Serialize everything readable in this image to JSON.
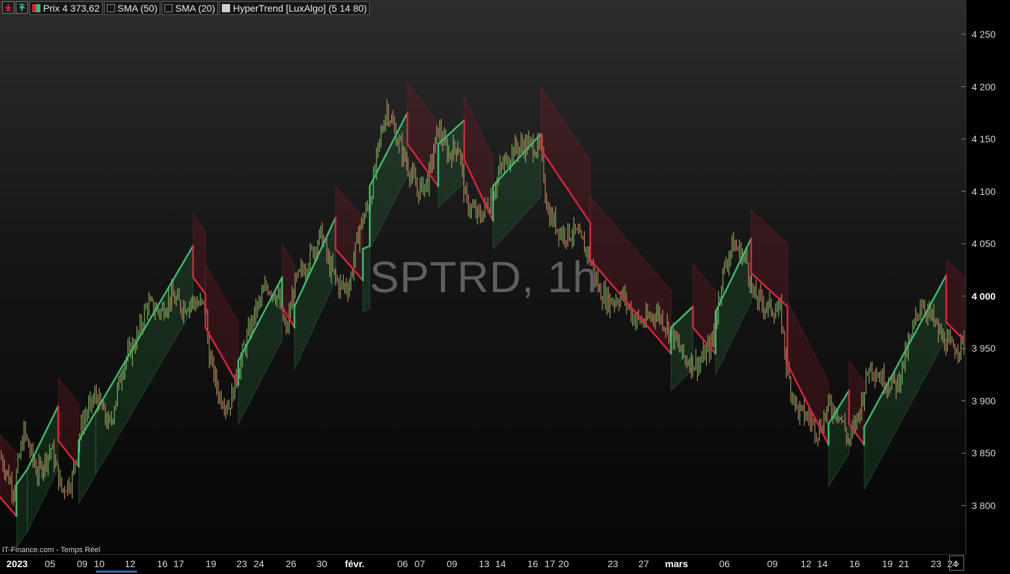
{
  "legend": {
    "price_label": "Prix 4 373,62",
    "sma50_label": "SMA (50)",
    "sma20_label": "SMA (20)",
    "hypertrend_label": "HyperTrend [LuxAlgo] (5 14 80)"
  },
  "watermark": "SPTRD, 1h",
  "source": "IT-Finance.com - Temps Réel",
  "colors": {
    "bull": "#3dbd6e",
    "bear": "#e0223f",
    "candle_up": "#8fd16a",
    "candle_down": "#d99a6a"
  },
  "chart_data": {
    "type": "line",
    "title": "SPTRD, 1h",
    "ylim": [
      3760,
      4280
    ],
    "y_ticks": [
      "4 250",
      "4 200",
      "4 150",
      "4 100",
      "4 050",
      "4 000",
      "3 950",
      "3 900",
      "3 850",
      "3 800"
    ],
    "x_ticks": [
      "2023",
      "05",
      "09",
      "10",
      "12",
      "16",
      "17",
      "19",
      "23",
      "24",
      "26",
      "30",
      "févr.",
      "06",
      "07",
      "09",
      "13",
      "14",
      "16",
      "17",
      "20",
      "23",
      "27",
      "mars",
      "06",
      "09",
      "12",
      "14",
      "16",
      "19",
      "21",
      "23",
      "24"
    ],
    "price": [
      [
        0,
        3848
      ],
      [
        20,
        3815
      ],
      [
        35,
        3870
      ],
      [
        55,
        3830
      ],
      [
        75,
        3855
      ],
      [
        90,
        3815
      ],
      [
        105,
        3825
      ],
      [
        120,
        3880
      ],
      [
        140,
        3905
      ],
      [
        160,
        3875
      ],
      [
        180,
        3935
      ],
      [
        200,
        3960
      ],
      [
        215,
        3992
      ],
      [
        235,
        3985
      ],
      [
        250,
        4000
      ],
      [
        265,
        3990
      ],
      [
        280,
        3995
      ],
      [
        300,
        3990
      ],
      [
        305,
        3945
      ],
      [
        320,
        3905
      ],
      [
        335,
        3895
      ],
      [
        350,
        3935
      ],
      [
        370,
        3980
      ],
      [
        390,
        4010
      ],
      [
        405,
        4000
      ],
      [
        418,
        3965
      ],
      [
        430,
        4010
      ],
      [
        450,
        4035
      ],
      [
        470,
        4060
      ],
      [
        480,
        4030
      ],
      [
        495,
        4010
      ],
      [
        510,
        4010
      ],
      [
        525,
        4065
      ],
      [
        540,
        4090
      ],
      [
        555,
        4150
      ],
      [
        565,
        4180
      ],
      [
        580,
        4150
      ],
      [
        595,
        4125
      ],
      [
        610,
        4100
      ],
      [
        625,
        4110
      ],
      [
        640,
        4160
      ],
      [
        655,
        4135
      ],
      [
        670,
        4145
      ],
      [
        680,
        4090
      ],
      [
        700,
        4075
      ],
      [
        715,
        4090
      ],
      [
        730,
        4120
      ],
      [
        750,
        4140
      ],
      [
        770,
        4145
      ],
      [
        790,
        4140
      ],
      [
        800,
        4080
      ],
      [
        820,
        4060
      ],
      [
        840,
        4060
      ],
      [
        860,
        4040
      ],
      [
        875,
        4005
      ],
      [
        890,
        3995
      ],
      [
        910,
        4000
      ],
      [
        925,
        3980
      ],
      [
        940,
        3975
      ],
      [
        960,
        3985
      ],
      [
        980,
        3965
      ],
      [
        1000,
        3940
      ],
      [
        1020,
        3935
      ],
      [
        1040,
        3955
      ],
      [
        1055,
        4020
      ],
      [
        1070,
        4050
      ],
      [
        1090,
        4035
      ],
      [
        1100,
        4000
      ],
      [
        1120,
        3990
      ],
      [
        1140,
        3985
      ],
      [
        1150,
        3925
      ],
      [
        1165,
        3890
      ],
      [
        1180,
        3885
      ],
      [
        1195,
        3870
      ],
      [
        1210,
        3895
      ],
      [
        1225,
        3890
      ],
      [
        1240,
        3860
      ],
      [
        1255,
        3890
      ],
      [
        1270,
        3935
      ],
      [
        1290,
        3920
      ],
      [
        1310,
        3915
      ],
      [
        1330,
        3960
      ],
      [
        1345,
        3995
      ],
      [
        1360,
        3980
      ],
      [
        1375,
        3960
      ],
      [
        1390,
        3950
      ],
      [
        1408,
        3955
      ]
    ],
    "hypertrend": [
      [
        0,
        3808,
        "bear"
      ],
      [
        24,
        3790,
        "bear"
      ],
      [
        24,
        3820,
        "bull"
      ],
      [
        40,
        3835,
        "bull"
      ],
      [
        85,
        3895,
        "bull"
      ],
      [
        85,
        3862,
        "bear"
      ],
      [
        115,
        3837,
        "bear"
      ],
      [
        115,
        3862,
        "bull"
      ],
      [
        140,
        3890,
        "bull"
      ],
      [
        282,
        4048,
        "bull"
      ],
      [
        282,
        4018,
        "bear"
      ],
      [
        300,
        4002,
        "bear"
      ],
      [
        300,
        3970,
        "bear"
      ],
      [
        348,
        3915,
        "bear"
      ],
      [
        348,
        3938,
        "bull"
      ],
      [
        412,
        4018,
        "bull"
      ],
      [
        412,
        3990,
        "bull"
      ],
      [
        430,
        3970,
        "bear"
      ],
      [
        430,
        3990,
        "bull"
      ],
      [
        490,
        4075,
        "bull"
      ],
      [
        490,
        4045,
        "bear"
      ],
      [
        530,
        4015,
        "bear"
      ],
      [
        530,
        4045,
        "bull"
      ],
      [
        540,
        4048,
        "bull"
      ],
      [
        540,
        4105,
        "bull"
      ],
      [
        595,
        4175,
        "bull"
      ],
      [
        595,
        4145,
        "bear"
      ],
      [
        640,
        4105,
        "bear"
      ],
      [
        640,
        4145,
        "bull"
      ],
      [
        678,
        4168,
        "bull"
      ],
      [
        678,
        4130,
        "bear"
      ],
      [
        720,
        4072,
        "bear"
      ],
      [
        720,
        4105,
        "bull"
      ],
      [
        790,
        4155,
        "bull"
      ],
      [
        790,
        4140,
        "bear"
      ],
      [
        862,
        4070,
        "bear"
      ],
      [
        862,
        4035,
        "bear"
      ],
      [
        980,
        3945,
        "bear"
      ],
      [
        980,
        3970,
        "bull"
      ],
      [
        1012,
        3990,
        "bull"
      ],
      [
        1012,
        3970,
        "bear"
      ],
      [
        1045,
        3945,
        "bear"
      ],
      [
        1045,
        3985,
        "bull"
      ],
      [
        1097,
        4055,
        "bull"
      ],
      [
        1097,
        4022,
        "bear"
      ],
      [
        1150,
        3990,
        "bear"
      ],
      [
        1150,
        3935,
        "bear"
      ],
      [
        1210,
        3858,
        "bear"
      ],
      [
        1210,
        3878,
        "bull"
      ],
      [
        1240,
        3910,
        "bull"
      ],
      [
        1240,
        3878,
        "bear"
      ],
      [
        1262,
        3858,
        "bear"
      ],
      [
        1262,
        3875,
        "bull"
      ],
      [
        1382,
        4020,
        "bull"
      ],
      [
        1382,
        3975,
        "bear"
      ],
      [
        1408,
        3958,
        "bear"
      ]
    ]
  }
}
